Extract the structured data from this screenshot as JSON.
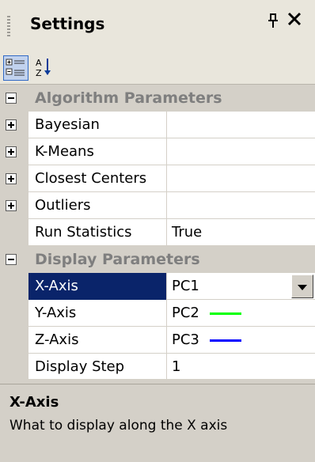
{
  "window": {
    "title": "Settings",
    "pin_glyph": "p",
    "close_glyph": "✕"
  },
  "toolbar": {
    "categorized": {
      "icon": "categorized-icon",
      "active": true
    },
    "alphabetical": {
      "icon": "sort-alpha-icon",
      "glyph": "A↓Z"
    }
  },
  "categories": [
    {
      "label": "Algorithm Parameters",
      "items": [
        {
          "label": "Bayesian",
          "value": "",
          "expandable": true
        },
        {
          "label": "K-Means",
          "value": "",
          "expandable": true
        },
        {
          "label": "Closest Centers",
          "value": "",
          "expandable": true
        },
        {
          "label": "Outliers",
          "value": "",
          "expandable": true
        },
        {
          "label": "Run Statistics",
          "value": "True",
          "expandable": false
        }
      ]
    },
    {
      "label": "Display Parameters",
      "items": [
        {
          "label": "X-Axis",
          "value": "PC1",
          "selected": true,
          "dropdown": true
        },
        {
          "label": "Y-Axis",
          "value": "PC2",
          "line_color": "#00ff00"
        },
        {
          "label": "Z-Axis",
          "value": "PC3",
          "line_color": "#0000ff"
        },
        {
          "label": "Display Step",
          "value": "1"
        }
      ]
    }
  ],
  "help": {
    "title": "X-Axis",
    "description": "What to display along the X axis"
  },
  "colors": {
    "selection": "#0a246a",
    "panel": "#d4d0c8"
  }
}
